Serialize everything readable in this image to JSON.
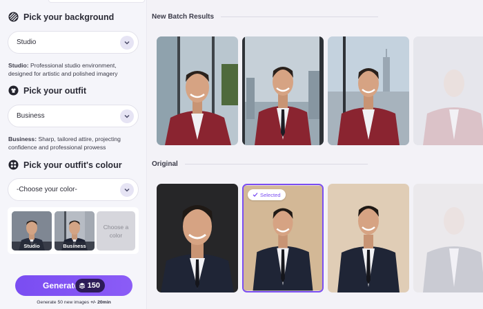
{
  "sidebar": {
    "background": {
      "title": "Pick your background",
      "icon": "stripes-icon",
      "selected": "Studio",
      "desc_term": "Studio:",
      "desc_text": " Professional studio environment, designed for artistic and polished imagery"
    },
    "outfit": {
      "title": "Pick your outfit",
      "icon": "shirt-icon",
      "selected": "Business",
      "desc_term": "Business:",
      "desc_text": " Sharp, tailored attire, projecting confidence and professional prowess"
    },
    "colour": {
      "title": "Pick your outfit's colour",
      "icon": "palette-icon",
      "placeholder": "-Choose your color-"
    },
    "thumbs": [
      {
        "label": "Studio"
      },
      {
        "label": "Business"
      }
    ],
    "choose_color": "Choose a color",
    "generate": {
      "label": "Generate",
      "credits": "150",
      "note_prefix": "Generate 50 new images ",
      "note_time": "+/- 20min"
    }
  },
  "main": {
    "batch_title": "New Batch Results",
    "original_title": "Original",
    "selected_badge": "Selected"
  },
  "colors": {
    "accent": "#7a4df2",
    "blazer_red": "#8a2430",
    "suit_navy": "#1f2536"
  }
}
